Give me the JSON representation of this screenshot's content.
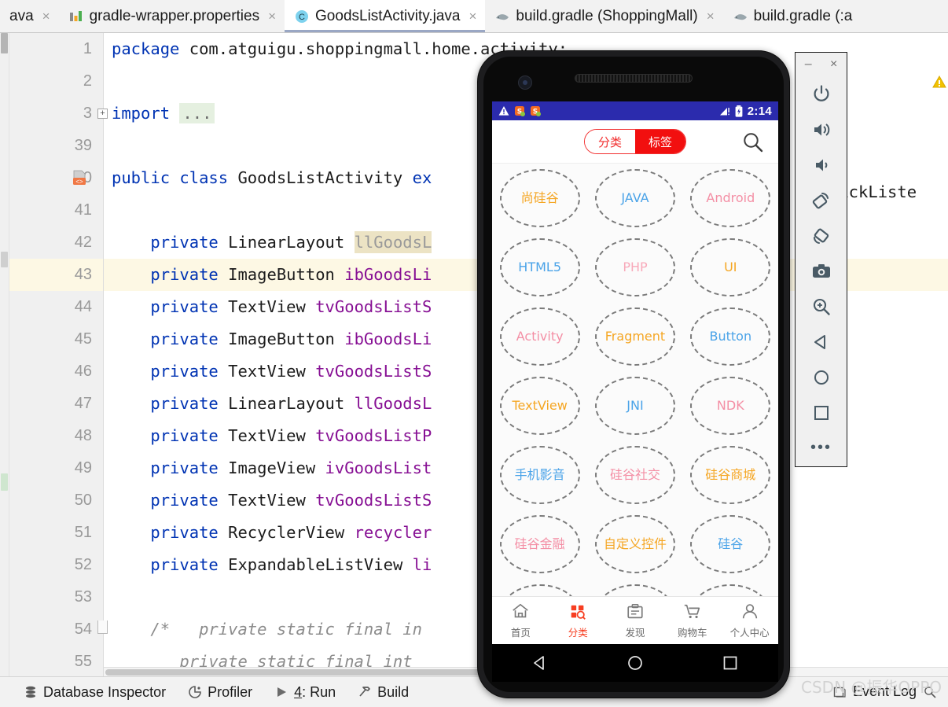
{
  "ide": {
    "tabs": [
      {
        "label": "ava",
        "icon": "java-file-icon",
        "active": false,
        "closable": true,
        "partial": true
      },
      {
        "label": "gradle-wrapper.properties",
        "icon": "properties-file-icon",
        "active": false,
        "closable": true
      },
      {
        "label": "GoodsListActivity.java",
        "icon": "java-class-icon",
        "active": true,
        "closable": true
      },
      {
        "label": "build.gradle (ShoppingMall)",
        "icon": "gradle-file-icon",
        "active": false,
        "closable": true
      },
      {
        "label": "build.gradle (:a",
        "icon": "gradle-file-icon",
        "active": false,
        "closable": false,
        "partial": true
      }
    ],
    "close_glyph": "×",
    "editor": {
      "lines": [
        {
          "no": "1",
          "segments": [
            {
              "t": "package ",
              "c": "kw"
            },
            {
              "t": "com.atguigu.shoppingmall.home.activity;",
              "c": "plain"
            }
          ]
        },
        {
          "no": "2",
          "segments": []
        },
        {
          "no": "3",
          "fold": "plus",
          "segments": [
            {
              "t": "import ",
              "c": "kw"
            },
            {
              "t": "...",
              "c": "importdots"
            }
          ]
        },
        {
          "no": "39",
          "segments": []
        },
        {
          "no": "40",
          "bean": true,
          "segments": [
            {
              "t": "public class ",
              "c": "kw"
            },
            {
              "t": "GoodsListActivity ",
              "c": "plain"
            },
            {
              "t": "ex",
              "c": "kw"
            }
          ]
        },
        {
          "no": "41",
          "segments": []
        },
        {
          "no": "42",
          "segments": [
            {
              "t": "    ",
              "c": "plain"
            },
            {
              "t": "private ",
              "c": "kw"
            },
            {
              "t": "LinearLayout ",
              "c": "plain"
            },
            {
              "t": "llGoodsL",
              "c": "hl-ident"
            }
          ]
        },
        {
          "no": "43",
          "current": true,
          "segments": [
            {
              "t": "    ",
              "c": "plain"
            },
            {
              "t": "private ",
              "c": "kw"
            },
            {
              "t": "ImageButton ",
              "c": "plain"
            },
            {
              "t": "ibGoodsLi",
              "c": "id"
            }
          ]
        },
        {
          "no": "44",
          "segments": [
            {
              "t": "    ",
              "c": "plain"
            },
            {
              "t": "private ",
              "c": "kw"
            },
            {
              "t": "TextView ",
              "c": "plain"
            },
            {
              "t": "tvGoodsListS",
              "c": "id"
            }
          ]
        },
        {
          "no": "45",
          "segments": [
            {
              "t": "    ",
              "c": "plain"
            },
            {
              "t": "private ",
              "c": "kw"
            },
            {
              "t": "ImageButton ",
              "c": "plain"
            },
            {
              "t": "ibGoodsLi",
              "c": "id"
            }
          ]
        },
        {
          "no": "46",
          "segments": [
            {
              "t": "    ",
              "c": "plain"
            },
            {
              "t": "private ",
              "c": "kw"
            },
            {
              "t": "TextView ",
              "c": "plain"
            },
            {
              "t": "tvGoodsListS",
              "c": "id"
            }
          ]
        },
        {
          "no": "47",
          "segments": [
            {
              "t": "    ",
              "c": "plain"
            },
            {
              "t": "private ",
              "c": "kw"
            },
            {
              "t": "LinearLayout ",
              "c": "plain"
            },
            {
              "t": "llGoodsL",
              "c": "id"
            }
          ]
        },
        {
          "no": "48",
          "segments": [
            {
              "t": "    ",
              "c": "plain"
            },
            {
              "t": "private ",
              "c": "kw"
            },
            {
              "t": "TextView ",
              "c": "plain"
            },
            {
              "t": "tvGoodsListP",
              "c": "id"
            }
          ]
        },
        {
          "no": "49",
          "segments": [
            {
              "t": "    ",
              "c": "plain"
            },
            {
              "t": "private ",
              "c": "kw"
            },
            {
              "t": "ImageView ",
              "c": "plain"
            },
            {
              "t": "ivGoodsList",
              "c": "id"
            }
          ]
        },
        {
          "no": "50",
          "segments": [
            {
              "t": "    ",
              "c": "plain"
            },
            {
              "t": "private ",
              "c": "kw"
            },
            {
              "t": "TextView ",
              "c": "plain"
            },
            {
              "t": "tvGoodsListS",
              "c": "id"
            }
          ]
        },
        {
          "no": "51",
          "segments": [
            {
              "t": "    ",
              "c": "plain"
            },
            {
              "t": "private ",
              "c": "kw"
            },
            {
              "t": "RecyclerView ",
              "c": "plain"
            },
            {
              "t": "recycler",
              "c": "id"
            }
          ]
        },
        {
          "no": "52",
          "segments": [
            {
              "t": "    ",
              "c": "plain"
            },
            {
              "t": "private ",
              "c": "kw"
            },
            {
              "t": "ExpandableListView ",
              "c": "plain"
            },
            {
              "t": "li",
              "c": "id"
            }
          ]
        },
        {
          "no": "53",
          "segments": []
        },
        {
          "no": "54",
          "fold": "minus",
          "segments": [
            {
              "t": "    /*   private static final in",
              "c": "cmt"
            }
          ]
        },
        {
          "no": "55",
          "segments": [
            {
              "t": "       private static final int ",
              "c": "cmt"
            }
          ]
        }
      ],
      "overflow_right_text": "lickListe",
      "warning_marker": "warning-triangle-icon"
    },
    "status_bar": {
      "items": [
        {
          "label": "Database Inspector",
          "icon": "database-icon"
        },
        {
          "label": "Profiler",
          "icon": "profiler-icon"
        },
        {
          "label": "4: Run",
          "icon": "run-play-icon",
          "mnemonic": "4"
        },
        {
          "label": "Build",
          "icon": "build-hammer-icon"
        }
      ],
      "right": {
        "label": "Event Log",
        "icon": "event-log-icon",
        "search_icon": "search-icon"
      }
    }
  },
  "emulator": {
    "device_frame": "pixel-phone-frame",
    "android_status": {
      "time": "2:14",
      "left_icons": [
        "warning-icon",
        "sogou-ime-icon",
        "sogou-ime-icon-2"
      ],
      "right_icons": [
        "signal-icon",
        "battery-charging-icon"
      ]
    },
    "app": {
      "header": {
        "segment_left": "分类",
        "segment_right": "标签",
        "active_segment": "right",
        "search_icon": "search-icon"
      },
      "tags": [
        [
          {
            "label": "尚硅谷",
            "color": "#f5a623"
          },
          {
            "label": "JAVA",
            "color": "#4aa3e8"
          },
          {
            "label": "Android",
            "color": "#f48fa5"
          }
        ],
        [
          {
            "label": "HTML5",
            "color": "#4aa3e8"
          },
          {
            "label": "PHP",
            "color": "#f8a9ba"
          },
          {
            "label": "UI",
            "color": "#f5a623"
          }
        ],
        [
          {
            "label": "Activity",
            "color": "#f48fa5"
          },
          {
            "label": "Fragment",
            "color": "#f5a623"
          },
          {
            "label": "Button",
            "color": "#4aa3e8"
          }
        ],
        [
          {
            "label": "TextView",
            "color": "#f5a623"
          },
          {
            "label": "JNI",
            "color": "#4aa3e8"
          },
          {
            "label": "NDK",
            "color": "#f48fa5"
          }
        ],
        [
          {
            "label": "手机影音",
            "color": "#4aa3e8"
          },
          {
            "label": "硅谷社交",
            "color": "#f48fa5"
          },
          {
            "label": "硅谷商城",
            "color": "#f5a623"
          }
        ],
        [
          {
            "label": "硅谷金融",
            "color": "#f48fa5"
          },
          {
            "label": "自定义控件",
            "color": "#f5a623"
          },
          {
            "label": "硅谷",
            "color": "#4aa3e8"
          }
        ]
      ],
      "bottom_tabs": [
        {
          "label": "首页",
          "icon": "home-icon",
          "active": false
        },
        {
          "label": "分类",
          "icon": "grid-search-icon",
          "active": true
        },
        {
          "label": "发现",
          "icon": "discover-icon",
          "active": false
        },
        {
          "label": "购物车",
          "icon": "cart-icon",
          "active": false
        },
        {
          "label": "个人中心",
          "icon": "person-icon",
          "active": false
        }
      ],
      "accent_color": "#f73e21"
    },
    "system_nav": [
      {
        "icon": "nav-back-icon"
      },
      {
        "icon": "nav-home-icon"
      },
      {
        "icon": "nav-overview-icon"
      }
    ],
    "toolbar": {
      "window_controls": [
        {
          "icon": "minimize-icon",
          "glyph": "–"
        },
        {
          "icon": "close-icon",
          "glyph": "×"
        }
      ],
      "buttons": [
        {
          "icon": "power-icon"
        },
        {
          "icon": "volume-up-icon"
        },
        {
          "icon": "volume-down-icon"
        },
        {
          "icon": "rotate-left-icon"
        },
        {
          "icon": "rotate-right-icon"
        },
        {
          "icon": "screenshot-camera-icon"
        },
        {
          "icon": "zoom-in-icon"
        },
        {
          "icon": "back-icon"
        },
        {
          "icon": "home-circle-icon"
        },
        {
          "icon": "overview-square-icon"
        },
        {
          "icon": "more-icon",
          "glyph": "•••"
        }
      ]
    }
  },
  "watermark": {
    "text": "CSDN @振华OPPO"
  }
}
